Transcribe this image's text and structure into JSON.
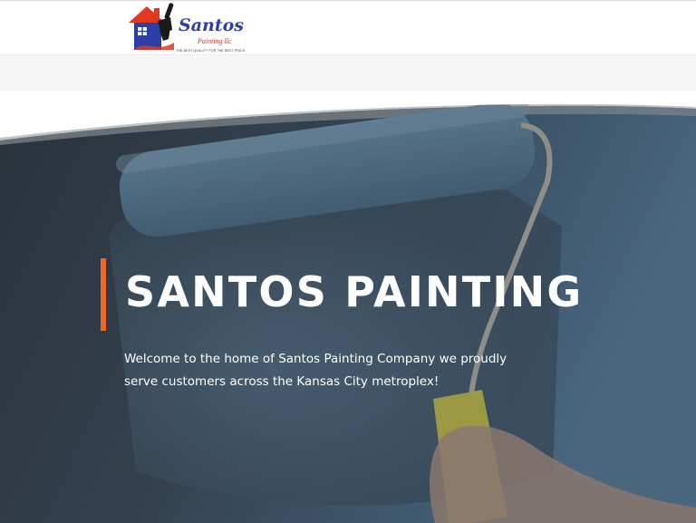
{
  "header": {
    "logo": {
      "script_text": "Santos",
      "sub_text": "Painting llc",
      "tagline": "THE BEST QUALITY FOR THE BEST PRICE"
    }
  },
  "hero": {
    "title": "Santos Painting",
    "text": " Welcome to the home of Santos Painting Company we proudly serve customers across the Kansas City metroplex!",
    "accent_color": "#f26522"
  },
  "colors": {
    "brand_blue": "#2c3fa8",
    "brand_red": "#e2371f",
    "hero_overlay": "#2f3a47"
  }
}
